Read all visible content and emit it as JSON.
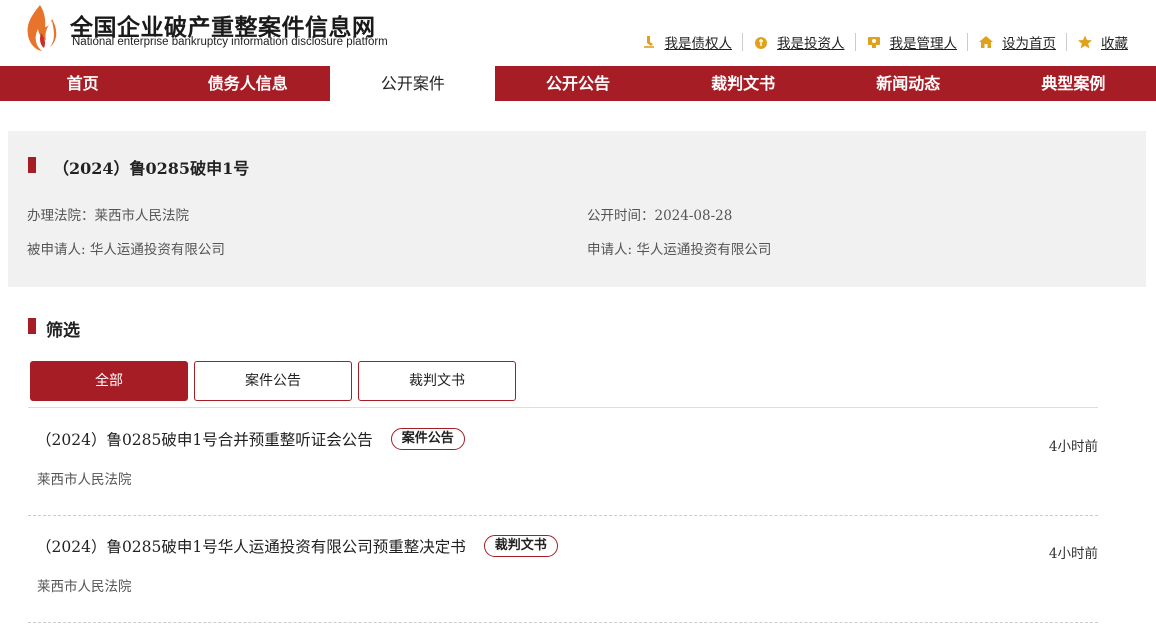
{
  "brand": {
    "title_cn": "全国企业破产重整案件信息网",
    "title_en": "National enterprise bankruptcy  information disclosure platform"
  },
  "top_links": [
    {
      "label": "我是债权人",
      "icon": "creditor-icon"
    },
    {
      "label": "我是投资人",
      "icon": "investor-icon"
    },
    {
      "label": "我是管理人",
      "icon": "administrator-icon"
    },
    {
      "label": "设为首页",
      "icon": "home-icon"
    },
    {
      "label": "收藏",
      "icon": "star-icon"
    }
  ],
  "nav": [
    {
      "label": "首页",
      "active": false
    },
    {
      "label": "债务人信息",
      "active": false
    },
    {
      "label": "公开案件",
      "active": true
    },
    {
      "label": "公开公告",
      "active": false
    },
    {
      "label": "裁判文书",
      "active": false
    },
    {
      "label": "新闻动态",
      "active": false
    },
    {
      "label": "典型案例",
      "active": false
    }
  ],
  "case": {
    "title": "（2024）鲁0285破申1号",
    "court": "办理法院：莱西市人民法院",
    "publish_time": "公开时间：2024-08-28",
    "respondent": "被申请人: 华人运通投资有限公司",
    "applicant": "申请人: 华人运通投资有限公司"
  },
  "filter": {
    "title": "筛选",
    "buttons": [
      {
        "label": "全部",
        "active": true
      },
      {
        "label": "案件公告",
        "active": false
      },
      {
        "label": "裁判文书",
        "active": false
      }
    ]
  },
  "items": [
    {
      "title": "（2024）鲁0285破申1号合并预重整听证会公告",
      "tag": "案件公告",
      "court": "莱西市人民法院",
      "time": "4小时前"
    },
    {
      "title": "（2024）鲁0285破申1号华人运通投资有限公司预重整决定书",
      "tag": "裁判文书",
      "court": "莱西市人民法院",
      "time": "4小时前"
    }
  ],
  "colors": {
    "primary": "#a71d25",
    "panel_bg": "#f1f1f1",
    "logo_orange": "#e8732a",
    "icon_gold": "#e0a21b"
  }
}
